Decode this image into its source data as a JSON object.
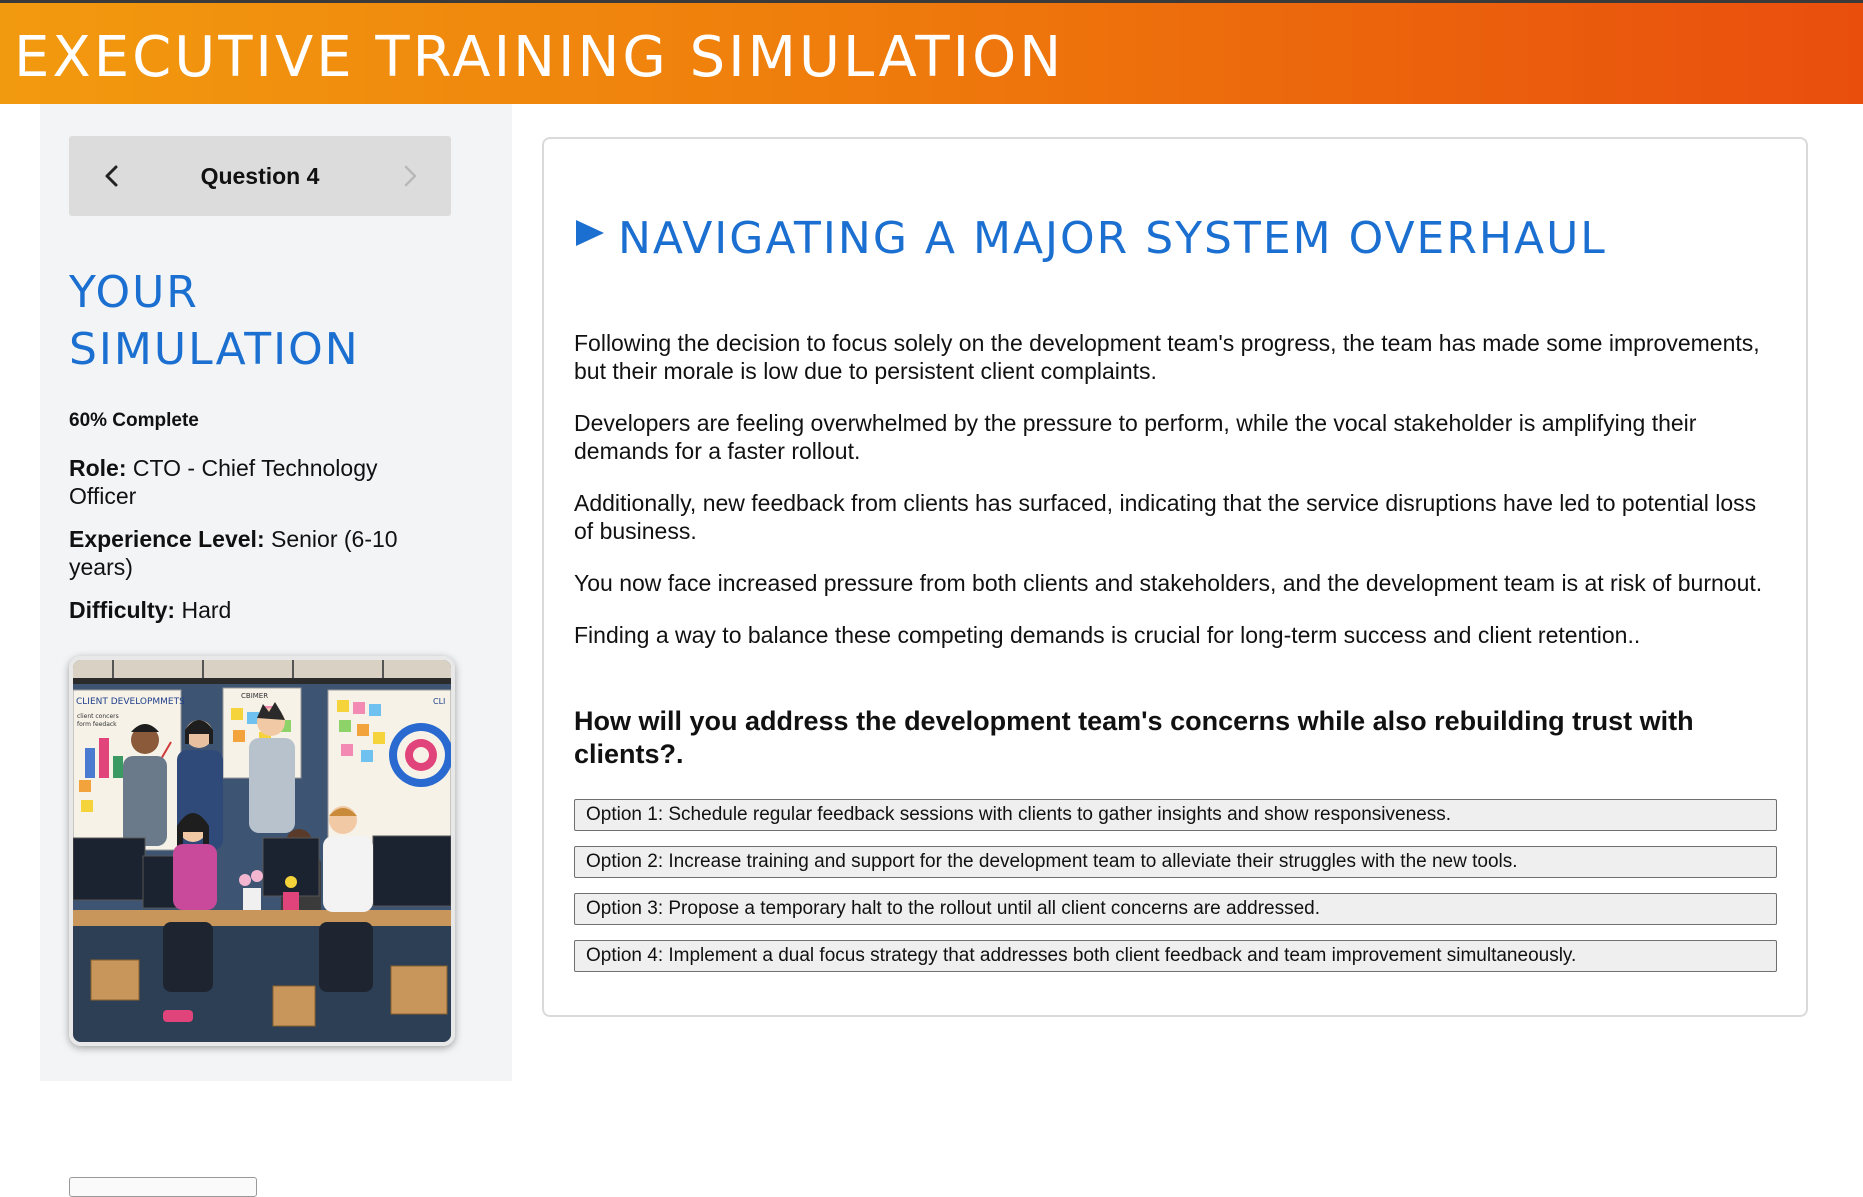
{
  "header": {
    "title": "EXECUTIVE TRAINING SIMULATION"
  },
  "sidebar": {
    "question_label": "Question 4",
    "sim_title_line1": "YOUR",
    "sim_title_line2": "SIMULATION",
    "progress_text": "60% Complete",
    "role_label": "Role:",
    "role_value": " CTO - Chief Technology Officer",
    "experience_label": "Experience Level:",
    "experience_value": " Senior (6-10 years)",
    "difficulty_label": "Difficulty:",
    "difficulty_value": " Hard",
    "illustration": {
      "board1": "CLIENT DEVELOPMMETS",
      "board1_lines": [
        "client concers",
        "form feedack"
      ],
      "board2": "CBIMER",
      "board3": "CLI"
    }
  },
  "scenario": {
    "title": "NAVIGATING A MAJOR SYSTEM OVERHAUL",
    "paragraphs": [
      "Following the decision to focus solely on the development team's progress, the team has made some improvements, but their morale is low due to persistent client complaints.",
      "Developers are feeling overwhelmed by the pressure to perform, while the vocal stakeholder is amplifying their demands for a faster rollout.",
      "Additionally, new feedback from clients has surfaced, indicating that the service disruptions have led to potential loss of business.",
      "You now face increased pressure from both clients and stakeholders, and the development team is at risk of burnout.",
      "Finding a way to balance these competing demands is crucial for long-term success and client retention.."
    ],
    "question": "How will you address the development team's concerns while also rebuilding trust with clients?.",
    "options": [
      "Option 1: Schedule regular feedback sessions with clients to gather insights and show responsiveness.",
      "Option 2: Increase training and support for the development team to alleviate their struggles with the new tools.",
      "Option 3: Propose a temporary halt to the rollout until all client concerns are addressed.",
      "Option 4: Implement a dual focus strategy that addresses both client feedback and team improvement simultaneously."
    ]
  },
  "colors": {
    "header_start": "#f29a0f",
    "header_end": "#e94e0d",
    "accent_blue": "#1a6fd0",
    "sidebar_bg": "#f3f4f6",
    "nav_bg": "#dcdcdc"
  },
  "icons": {
    "prev": "chevron-left-icon",
    "next": "chevron-right-icon",
    "title_marker": "play-triangle-icon"
  }
}
